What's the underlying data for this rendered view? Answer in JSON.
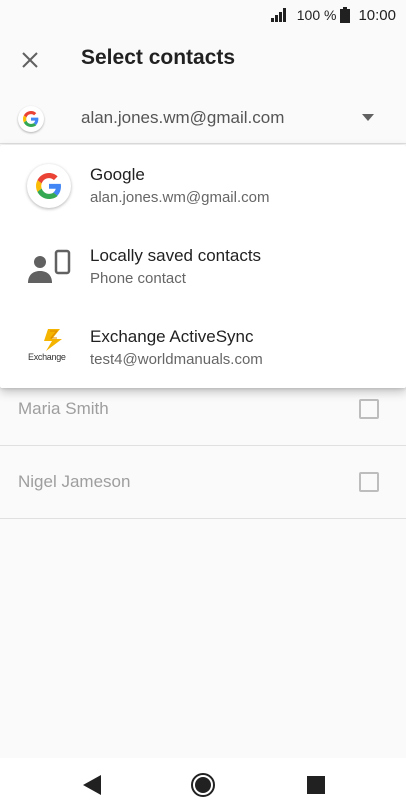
{
  "status_bar": {
    "battery_percent": "100 %",
    "time": "10:00"
  },
  "app_bar": {
    "title": "Select contacts"
  },
  "account_selector": {
    "selected_account": "alan.jones.wm@gmail.com"
  },
  "contacts": [
    {
      "name": "Maria Smith",
      "checked": false
    },
    {
      "name": "Nigel Jameson",
      "checked": false
    }
  ],
  "account_menu": {
    "items": [
      {
        "title": "Google",
        "subtitle": "alan.jones.wm@gmail.com",
        "icon": "google-icon"
      },
      {
        "title": "Locally saved contacts",
        "subtitle": "Phone contact",
        "icon": "phone-contact-icon"
      },
      {
        "title": "Exchange ActiveSync",
        "subtitle": "test4@worldmanuals.com",
        "icon": "exchange-icon"
      }
    ],
    "exchange_logo_text": "Exchange"
  },
  "colors": {
    "google_blue": "#4285F4",
    "google_red": "#EA4335",
    "google_yellow": "#FBBC05",
    "google_green": "#34A853",
    "icon_grey": "#616161"
  }
}
